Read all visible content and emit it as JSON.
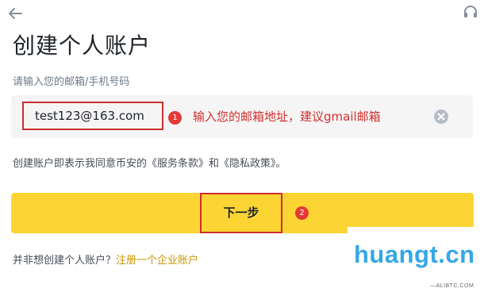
{
  "header": {
    "back_icon": "arrow-left-icon",
    "support_icon": "headset-icon",
    "title": "创建个人账户"
  },
  "form": {
    "email_label": "请输入您的邮箱/手机号码",
    "email_value": "test123@163.com",
    "clear_icon": "clear-circle-icon",
    "agreement_text": "创建账户即表示我同意币安的《服务条款》和《隐私政策》。",
    "next_label": "下一步"
  },
  "annotations": {
    "marker_1": "1",
    "note_1": "输入您的邮箱地址，建议gmail邮箱",
    "marker_2": "2"
  },
  "footer": {
    "question": "并非想创建个人账户？",
    "link": "注册一个企业账户"
  },
  "watermark": {
    "text": "huangt.cn",
    "subtext": "—ALIBTC.COM"
  },
  "colors": {
    "primary_yellow": "#fcd535",
    "link_gold": "#c99400",
    "annotation_red": "#d32f2f",
    "watermark_blue": "#35a7e6"
  }
}
